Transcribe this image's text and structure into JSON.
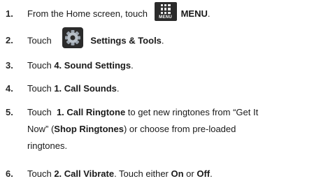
{
  "steps": [
    {
      "num": "1.",
      "pre": "From the Home screen, touch ",
      "icon_label": "MENU",
      "bold": "MENU",
      "post": "."
    },
    {
      "num": "2.",
      "pre": "Touch ",
      "bold": "Settings & Tools",
      "post": "."
    },
    {
      "num": "3.",
      "pre": "Touch ",
      "bold": "4. Sound Settings",
      "post": "."
    },
    {
      "num": "4.",
      "pre": "Touch ",
      "bold": "1. Call Sounds",
      "post": "."
    },
    {
      "num": "5.",
      "pre": "Touch ",
      "bold1": "1. Call Ringtone",
      "mid1": " to get new ringtones from “Get It",
      "line2_pre": "Now” (",
      "bold2": "Shop Ringtones",
      "line2_post": ") or choose from pre-loaded",
      "line3": "ringtones."
    },
    {
      "num": "6.",
      "pre": "Touch ",
      "bold1": "2. Call Vibrate",
      "mid": ". Touch either ",
      "bold2": "On",
      "or": " or ",
      "bold3": "Off",
      "post": "."
    }
  ],
  "icons": {
    "step1": "menu-grid-icon",
    "step2": "settings-gear-icon"
  },
  "colors": {
    "icon_bg": "#2b2b2b",
    "text": "#1a1a1a"
  }
}
